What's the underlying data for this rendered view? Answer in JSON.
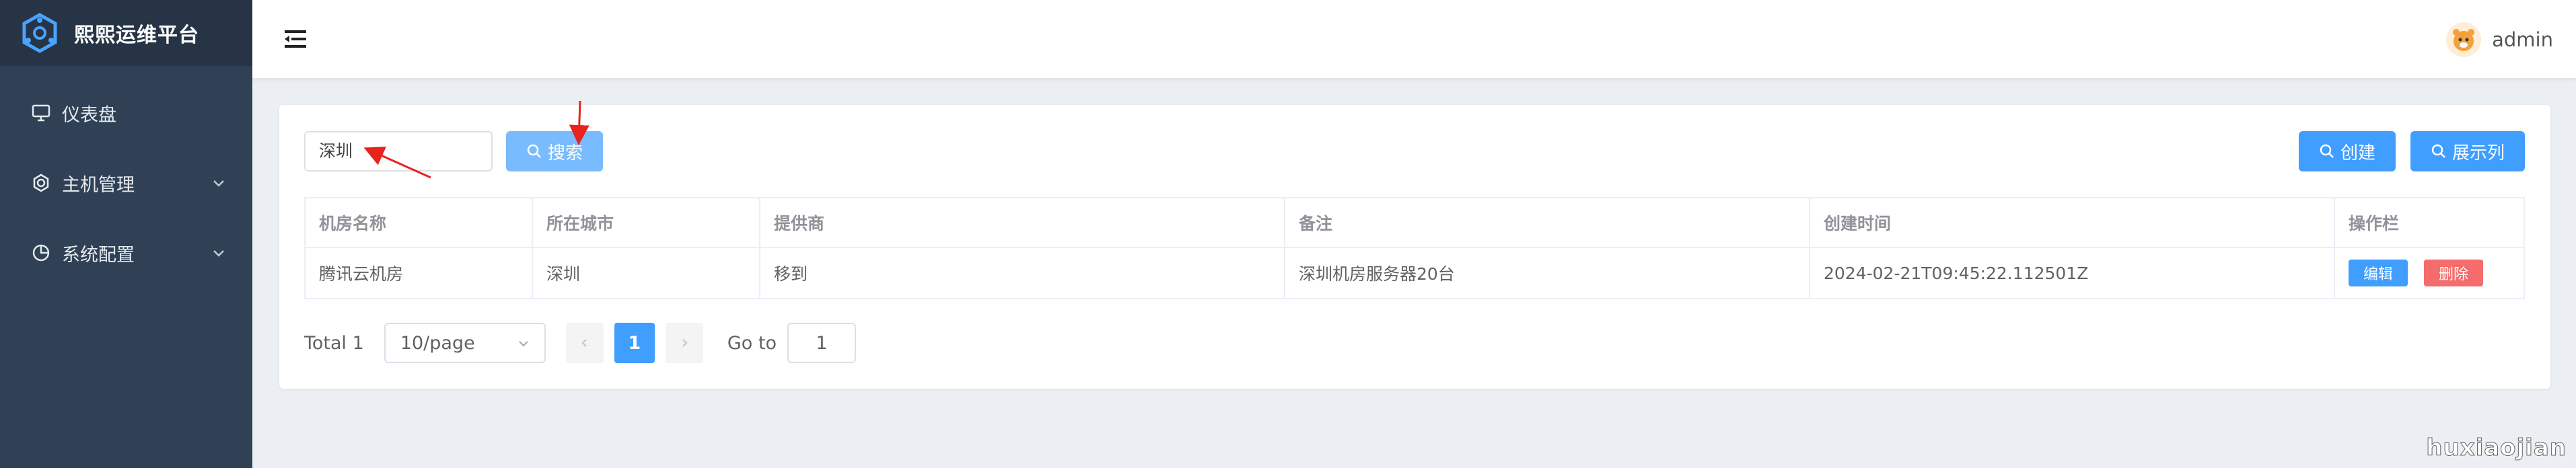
{
  "app": {
    "title": "熙熙运维平台"
  },
  "sidebar": {
    "items": [
      {
        "label": "仪表盘",
        "icon": "monitor-icon"
      },
      {
        "label": "主机管理",
        "icon": "gear-icon"
      },
      {
        "label": "系统配置",
        "icon": "pie-chart-icon"
      }
    ]
  },
  "header": {
    "username": "admin"
  },
  "toolbar": {
    "search_value": "深圳",
    "search_label": "搜索",
    "create_label": "创建",
    "columns_label": "展示列"
  },
  "table": {
    "columns": [
      "机房名称",
      "所在城市",
      "提供商",
      "备注",
      "创建时间",
      "操作栏"
    ],
    "rows": [
      {
        "name": "腾讯云机房",
        "city": "深圳",
        "provider": "移到",
        "note": "深圳机房服务器20台",
        "created": "2024-02-21T09:45:22.112501Z",
        "edit_label": "编辑",
        "delete_label": "删除"
      }
    ]
  },
  "pagination": {
    "total_text": "Total 1",
    "page_size": "10/page",
    "current_page": "1",
    "goto_label": "Go to",
    "goto_value": "1"
  },
  "watermark": "huxiaojian",
  "colors": {
    "primary": "#409eff",
    "danger": "#f56c6c",
    "sidebar": "#304156",
    "annotation_arrow": "#e8231c"
  }
}
